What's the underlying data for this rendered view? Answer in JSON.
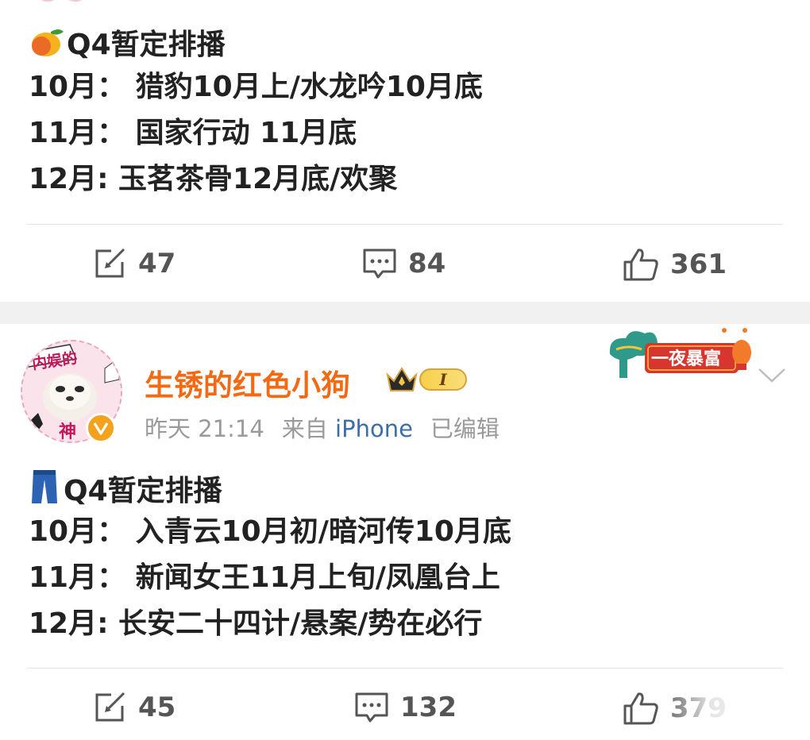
{
  "post1": {
    "lines": [
      "Q4暂定排播",
      "10月：  猎豹10月上/水龙吟10月底",
      "11月：  国家行动 11月底",
      "12月: 玉茗茶骨12月底/欢聚"
    ],
    "lead_icon": "mango-icon",
    "actions": {
      "repost": "47",
      "comment": "84",
      "like": "361"
    }
  },
  "post2": {
    "user": {
      "name": "生锈的红色小狗",
      "avatar_text_top": "内娱的",
      "avatar_text_bottom": "神",
      "level_badge": "I"
    },
    "meta": {
      "time": "昨天 21:14",
      "from_label": "来自",
      "source": "iPhone",
      "edited": "已编辑"
    },
    "decoration_text": "一夜暴富",
    "lines": [
      "Q4暂定排播",
      "10月：  入青云10月初/暗河传10月底",
      "11月：  新闻女王11月上旬/凤凰台上",
      "12月: 长安二十四计/悬案/势在必行"
    ],
    "lead_icon": "jeans-icon",
    "actions": {
      "repost": "45",
      "comment": "132",
      "like": "379"
    }
  },
  "colors": {
    "username": "#f26a14",
    "source_link": "#3b6eaa",
    "meta": "#9a9a9a",
    "separator": "#f1f1f1"
  }
}
